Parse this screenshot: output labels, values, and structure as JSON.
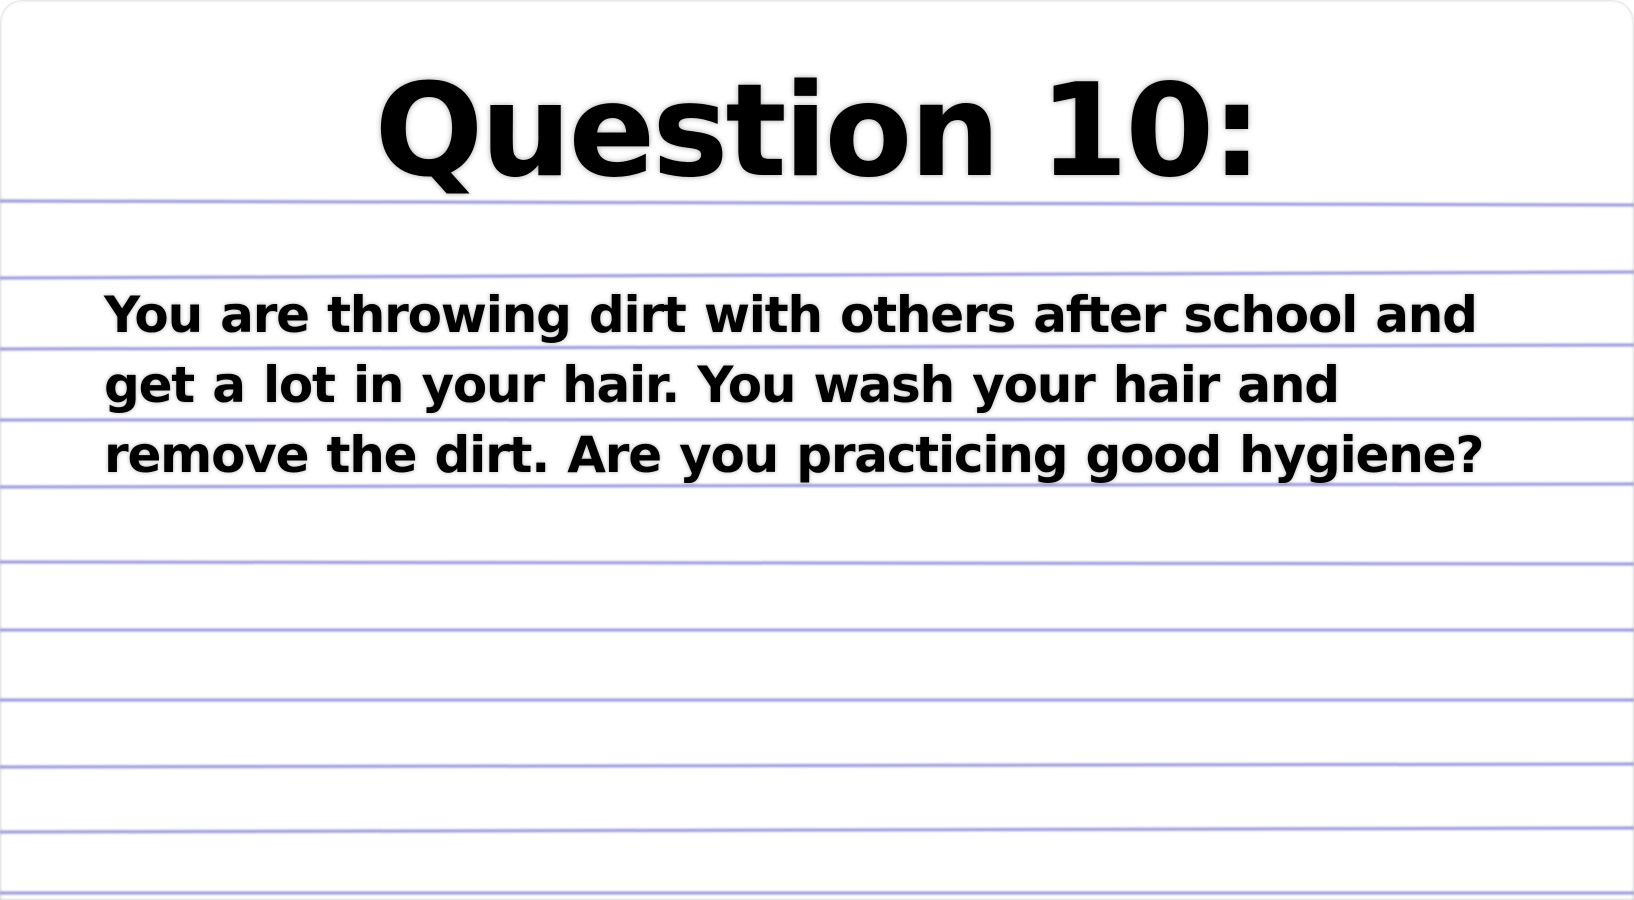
{
  "slide": {
    "title": "Question 10:",
    "question_text": "You are throwing dirt with others after school and get a lot in your hair. You wash your hair and remove the dirt. Are you practicing good hygiene?"
  },
  "colors": {
    "background": "#ffffff",
    "text": "#000000",
    "rule_line": "#8c8cd8"
  }
}
